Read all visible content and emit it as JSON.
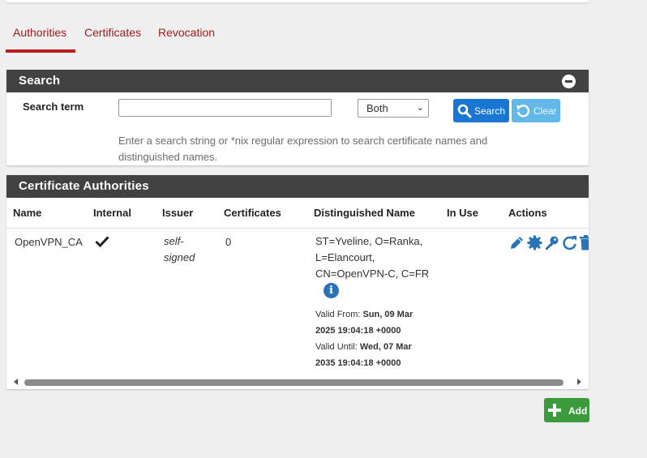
{
  "tabs": [
    {
      "label": "Authorities",
      "active": true
    },
    {
      "label": "Certificates",
      "active": false
    },
    {
      "label": "Revocation",
      "active": false
    }
  ],
  "search_panel": {
    "title": "Search",
    "label": "Search term",
    "input_value": "",
    "scope_selected": "Both",
    "search_button": "Search",
    "clear_button": "Clear",
    "help": "Enter a search string or *nix regular expression to search certificate names and distinguished names."
  },
  "ca_panel": {
    "title": "Certificate Authorities",
    "columns": [
      "Name",
      "Internal",
      "Issuer",
      "Certificates",
      "Distinguished Name",
      "In Use",
      "Actions"
    ],
    "rows": [
      {
        "name": "OpenVPN_CA",
        "internal": true,
        "issuer_line1": "self-",
        "issuer_line2": "signed",
        "certificates": "0",
        "dn_lines": [
          "ST=Yveline, O=Ranka,",
          "L=Elancourt,",
          "CN=OpenVPN-C, C=FR"
        ],
        "valid_from_label": "Valid From:",
        "valid_from_line1": "Sun, 09 Mar",
        "valid_from_line2": "2025 19:04:18 +0000",
        "valid_until_label": "Valid Until:",
        "valid_until_line1": "Wed, 07 Mar",
        "valid_until_line2": "2035 19:04:18 +0000",
        "in_use": ""
      }
    ],
    "action_icons": [
      "pencil-icon",
      "gear-icon",
      "key-icon",
      "refresh-icon",
      "trash-icon"
    ]
  },
  "add_button": "Add",
  "colors": {
    "accent_red": "#a01b1b",
    "panel_header": "#424242",
    "primary_blue": "#1976d2",
    "info_blue": "#62b8e6",
    "success_green": "#3b9a3b",
    "icon_blue": "#2b73b7"
  }
}
